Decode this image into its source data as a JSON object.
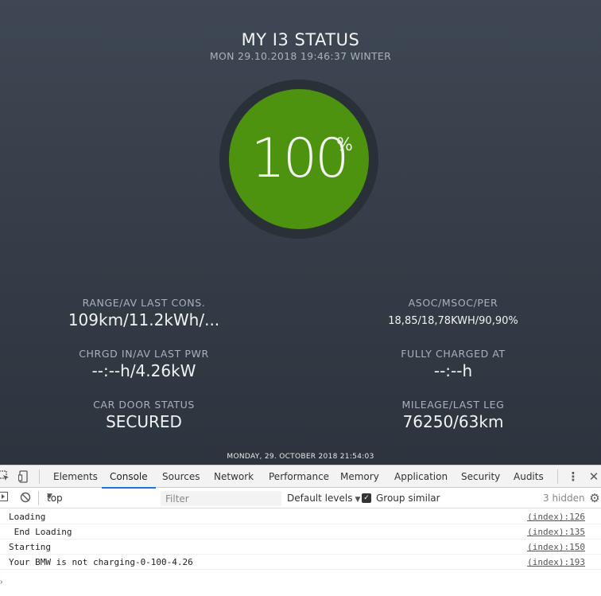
{
  "dashboard": {
    "title": "MY I3 STATUS",
    "subtitle": "MON 29.10.2018 19:46:37 WINTER",
    "charge": {
      "value": "100",
      "unit": "%"
    },
    "stats": [
      {
        "label": "RANGE/AV LAST CONS.",
        "value": "109km/11.2kWh/..."
      },
      {
        "label": "ASOC/MSOC/PER",
        "value": "18,85/18,78KWH/90,90%"
      },
      {
        "label": "CHRGD IN/AV LAST PWR",
        "value": "--:--h/4.26kW"
      },
      {
        "label": "FULLY CHARGED AT",
        "value": "--:--h"
      },
      {
        "label": "CAR DOOR STATUS",
        "value": "SECURED"
      },
      {
        "label": "MILEAGE/LAST LEG",
        "value": "76250/63km"
      }
    ],
    "footer_date": "MONDAY, 29. OCTOBER 2018 21:54:03",
    "colors": {
      "charge_green": "#4e9310",
      "ring": "#2a3038"
    }
  },
  "devtools": {
    "tabs": [
      "Elements",
      "Console",
      "Sources",
      "Network",
      "Performance",
      "Memory",
      "Application",
      "Security",
      "Audits"
    ],
    "active_tab": "Console",
    "icons": {
      "inspect": "inspect-element-icon",
      "device": "device-toolbar-icon",
      "more": "more-vertical-icon",
      "close": "close-icon"
    },
    "toolbar": {
      "context": "top",
      "filter_placeholder": "Filter",
      "levels": "Default levels",
      "group_similar": "Group similar",
      "group_similar_checked": true,
      "hidden_count": "3 hidden"
    },
    "messages": [
      {
        "text": "Loading",
        "source": "(index):126"
      },
      {
        "text": " End Loading",
        "source": "(index):135"
      },
      {
        "text": "Starting",
        "source": "(index):150"
      },
      {
        "text": "Your BMW is not charging-0-100-4.26",
        "source": "(index):193"
      }
    ],
    "accent": "#1a73e8"
  }
}
